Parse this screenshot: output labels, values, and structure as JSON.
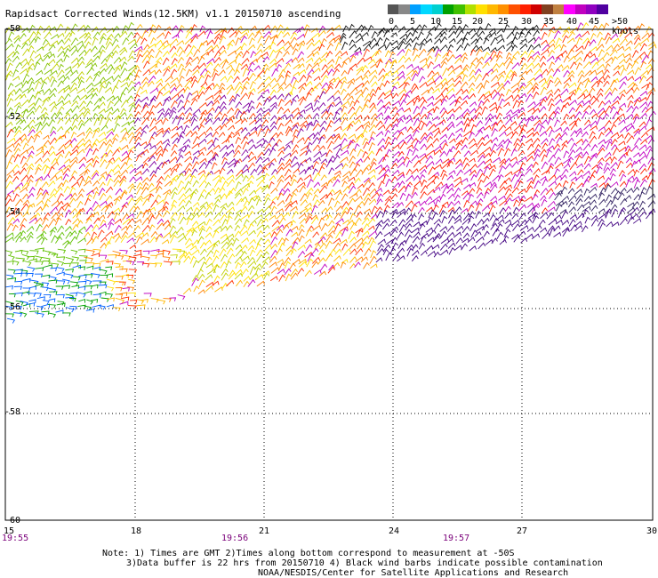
{
  "title": "Rapidsact Corrected Winds(12.5KM) v1.1 20150710 ascending",
  "legend": {
    "colors": [
      "#555555",
      "#888888",
      "#00a0ff",
      "#00d8ff",
      "#00d0d0",
      "#00a000",
      "#40c000",
      "#b0e000",
      "#ffe000",
      "#ffb800",
      "#ff9000",
      "#ff5000",
      "#ff2000",
      "#d00000",
      "#804020",
      "#c08040",
      "#ff00ff",
      "#c000c0",
      "#9000c0",
      "#5000a0"
    ],
    "labels": [
      "0",
      "5",
      "10",
      "15",
      "20",
      "25",
      "30",
      "35",
      "40",
      "45",
      ">50 knots"
    ]
  },
  "lat_labels": [
    "-50",
    "-52",
    "-54",
    "-56",
    "-58",
    "-60"
  ],
  "lon_labels": [
    "15",
    "18",
    "21",
    "24",
    "27",
    "30"
  ],
  "time_labels": [
    "19:55",
    "19:56",
    "19:57"
  ],
  "notes": {
    "line1": "Note: 1) Times are GMT 2)Times along bottom correspond to measurement at -50S",
    "line2": "3)Data buffer is 22 hrs from 20150710 4) Black wind barbs indicate possible contamination",
    "line3": "NOAA/NESDIS/Center for Satellite Applications and Research"
  }
}
